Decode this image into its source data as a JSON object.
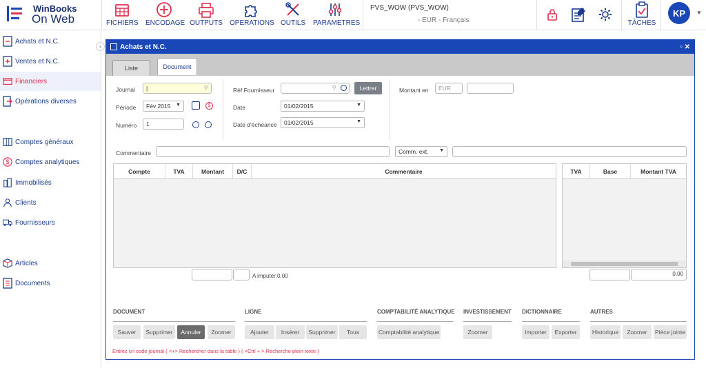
{
  "logo": {
    "brand_line1": "WinBooks",
    "brand_line2": "On Web"
  },
  "toolbar": [
    {
      "label": "FICHIERS",
      "icon": "grid-icon"
    },
    {
      "label": "ENCODAGE",
      "icon": "plus-circle-icon"
    },
    {
      "label": "OUTPUTS",
      "icon": "printer-icon"
    },
    {
      "label": "OPERATIONS",
      "icon": "puzzle-icon"
    },
    {
      "label": "OUTILS",
      "icon": "tools-icon"
    },
    {
      "label": "PARAMETRES",
      "icon": "sliders-icon"
    }
  ],
  "company": {
    "name": "PVS_WOW (PVS_WOW)",
    "currency": "EUR",
    "language": "Français"
  },
  "right": {
    "taches": "TÂCHES",
    "avatar": "KP"
  },
  "sidebar": [
    {
      "label": "Achats et N.C.",
      "icon": "minus-doc-icon"
    },
    {
      "label": "Ventes et N.C.",
      "icon": "plus-doc-icon"
    },
    {
      "label": "Financiers",
      "icon": "card-icon"
    },
    {
      "label": "Opérations diverses",
      "icon": "arrow-doc-icon"
    },
    {
      "label": "Comptes généraux",
      "icon": "ledger-icon"
    },
    {
      "label": "Comptes analytiques",
      "icon": "dollar-icon"
    },
    {
      "label": "Immobilisés",
      "icon": "building-icon"
    },
    {
      "label": "Clients",
      "icon": "users-icon"
    },
    {
      "label": "Fournisseurs",
      "icon": "truck-icon"
    },
    {
      "label": "Articles",
      "icon": "box-icon"
    },
    {
      "label": "Documents",
      "icon": "documents-icon"
    }
  ],
  "window": {
    "title": "Achats et N.C.",
    "tab_list": "Liste",
    "tab_document": "Document"
  },
  "form": {
    "journal_label": "Journal",
    "periode_label": "Période",
    "periode_value": "Fév 2015",
    "numero_label": "Numéro",
    "numero_value": "1",
    "ref_label": "Réf.Fournisseur",
    "lettrer": "Lettrer",
    "date_label": "Date",
    "date_value": "01/02/2015",
    "echeance_label": "Date d'échéance",
    "echeance_value": "01/02/2015",
    "montant_label": "Montant en",
    "montant_currency": "EUR",
    "commentaire_label": "Commentaire",
    "comm_ext": "Comm. ext."
  },
  "grid": {
    "columns": [
      "Compte",
      "TVA",
      "Montant",
      "D/C",
      "Commentaire"
    ],
    "vat_columns": [
      "TVA",
      "Base",
      "Montant TVA"
    ],
    "a_imputer": "A imputer:0,00",
    "vat_total": "0,00"
  },
  "actions": [
    {
      "section": "DOCUMENT",
      "buttons": [
        "Sauver",
        "Supprimer",
        "Annuler",
        "Zoomer"
      ]
    },
    {
      "section": "LIGNE",
      "buttons": [
        "Ajouter",
        "Insérer",
        "Supprimer",
        "Tous"
      ]
    },
    {
      "section": "COMPTABILITÉ ANALYTIQUE",
      "buttons": [
        "Comptabilité analytique"
      ]
    },
    {
      "section": "INVESTISSEMENT",
      "buttons": [
        "Zoomer"
      ]
    },
    {
      "section": "DICTIONNAIRE",
      "buttons": [
        "Importer",
        "Exporter"
      ]
    },
    {
      "section": "AUTRES",
      "buttons": [
        "Historique",
        "Zoomer",
        "Pièce jointe"
      ]
    }
  ],
  "hint": "Entrez un code journal ( <+> Rechercher dans la table ) ( <Ctrl + > Recherche plein texte )",
  "colors": {
    "brand": "#1a47b8",
    "accent": "#e03050",
    "nav": "#1a3c8f"
  }
}
